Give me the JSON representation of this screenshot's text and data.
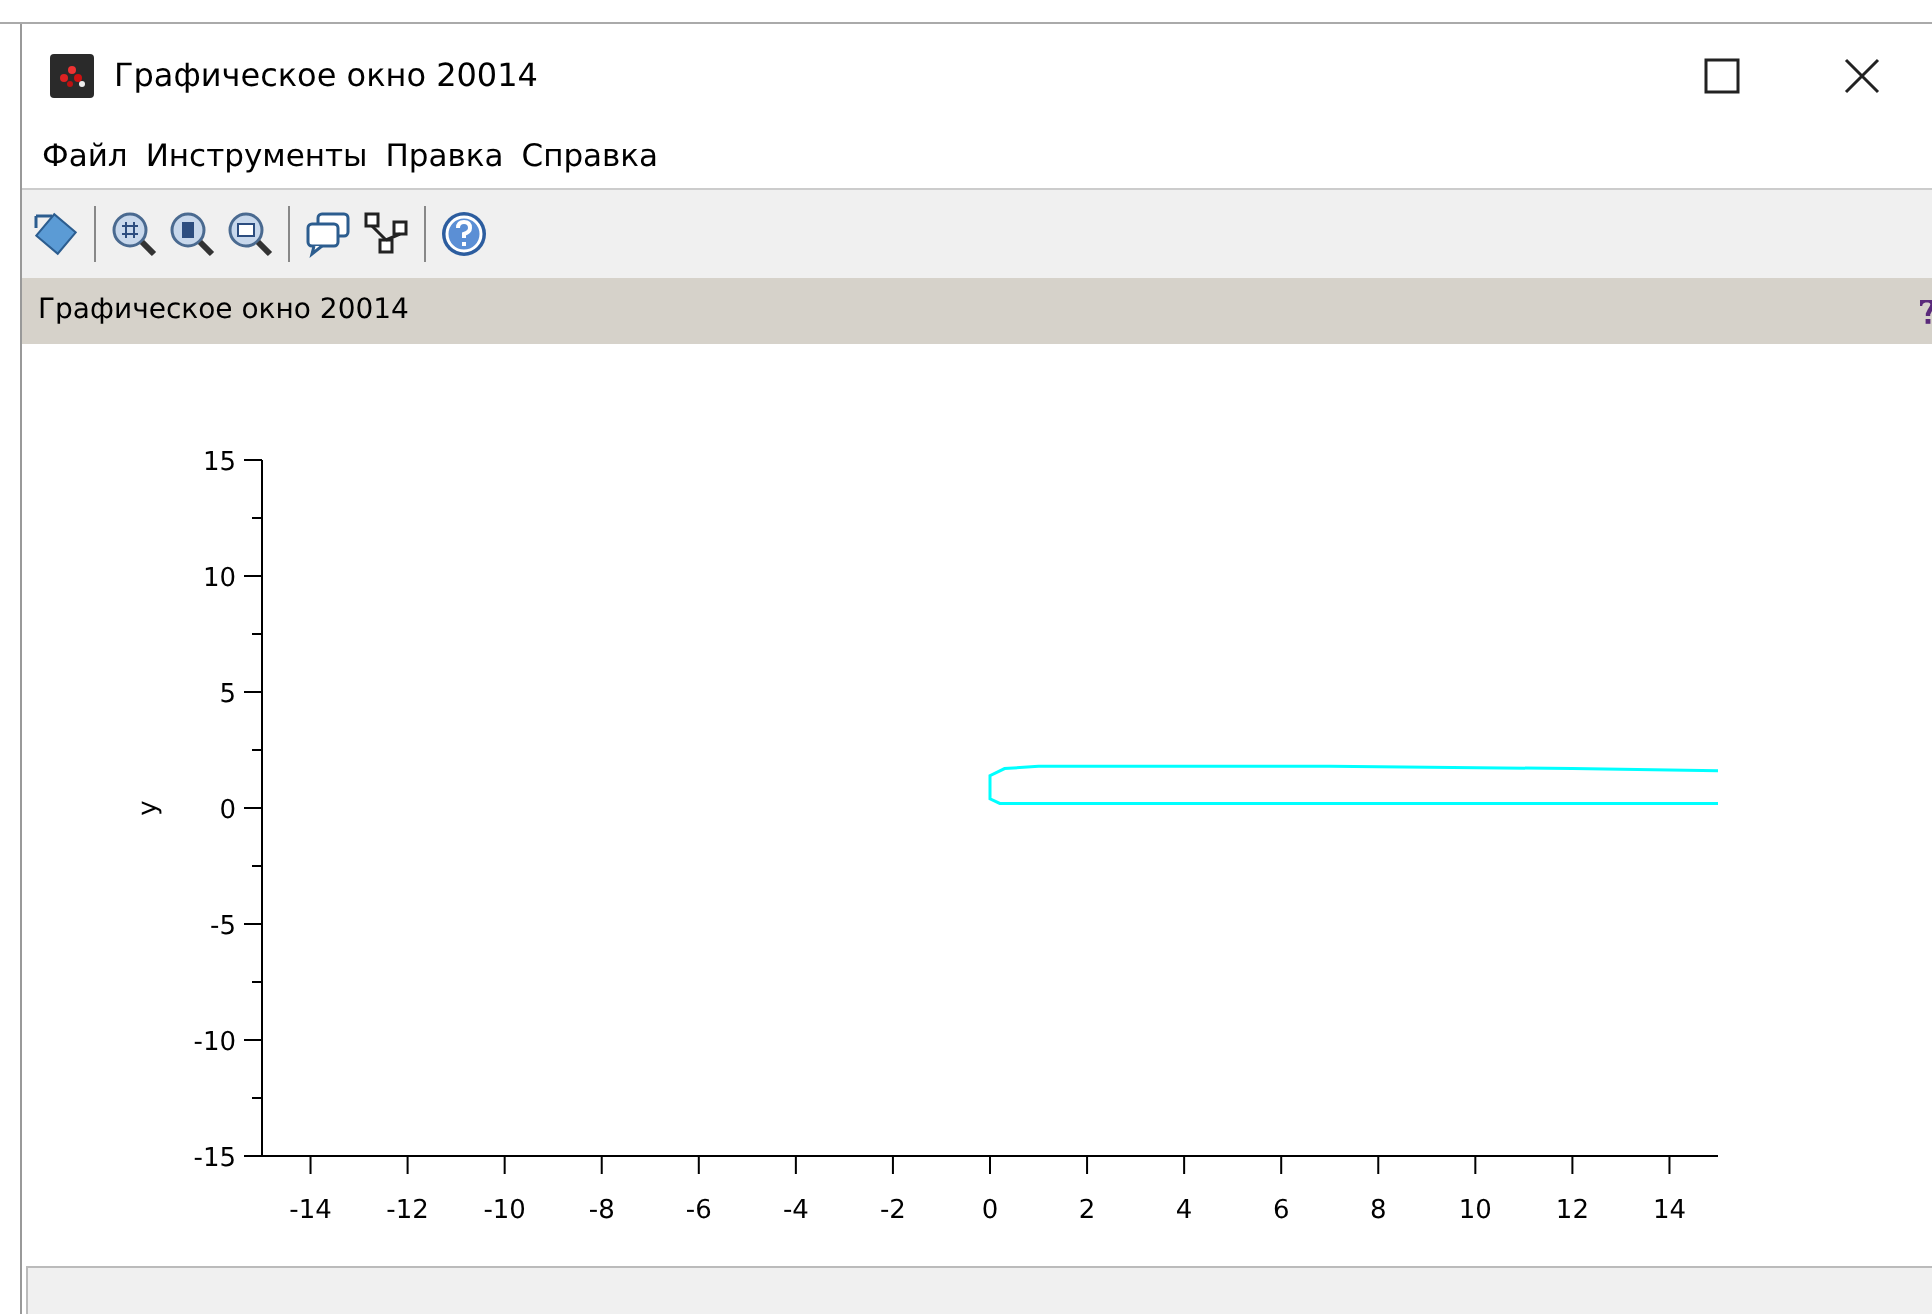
{
  "window": {
    "title": "Графическое окно 20014"
  },
  "menu": [
    "Файл",
    "Инструменты",
    "Правка",
    "Справка"
  ],
  "toolbar": [
    {
      "kind": "rotate"
    },
    {
      "kind": "sep"
    },
    {
      "kind": "zoom-grid"
    },
    {
      "kind": "zoom-one"
    },
    {
      "kind": "zoom-area"
    },
    {
      "kind": "sep"
    },
    {
      "kind": "datatip"
    },
    {
      "kind": "editor"
    },
    {
      "kind": "sep"
    },
    {
      "kind": "help"
    }
  ],
  "figure": {
    "header": "Графическое окно 20014",
    "chart_data": {
      "type": "line",
      "ylabel": "y",
      "xlim": [
        -15,
        15
      ],
      "ylim": [
        -15,
        15
      ],
      "xticks": [
        -14,
        -12,
        -10,
        -8,
        -6,
        -4,
        -2,
        0,
        2,
        4,
        6,
        8,
        10,
        12,
        14
      ],
      "yticks": [
        -15,
        -10,
        -5,
        0,
        5,
        10,
        15
      ],
      "series": [
        {
          "color": "#00ffff",
          "x": [
            15,
            0.2,
            0,
            0,
            0.3,
            1,
            7,
            12,
            15
          ],
          "values": [
            0.2,
            0.2,
            0.4,
            1.4,
            1.7,
            1.8,
            1.8,
            1.7,
            1.6
          ]
        }
      ]
    }
  }
}
